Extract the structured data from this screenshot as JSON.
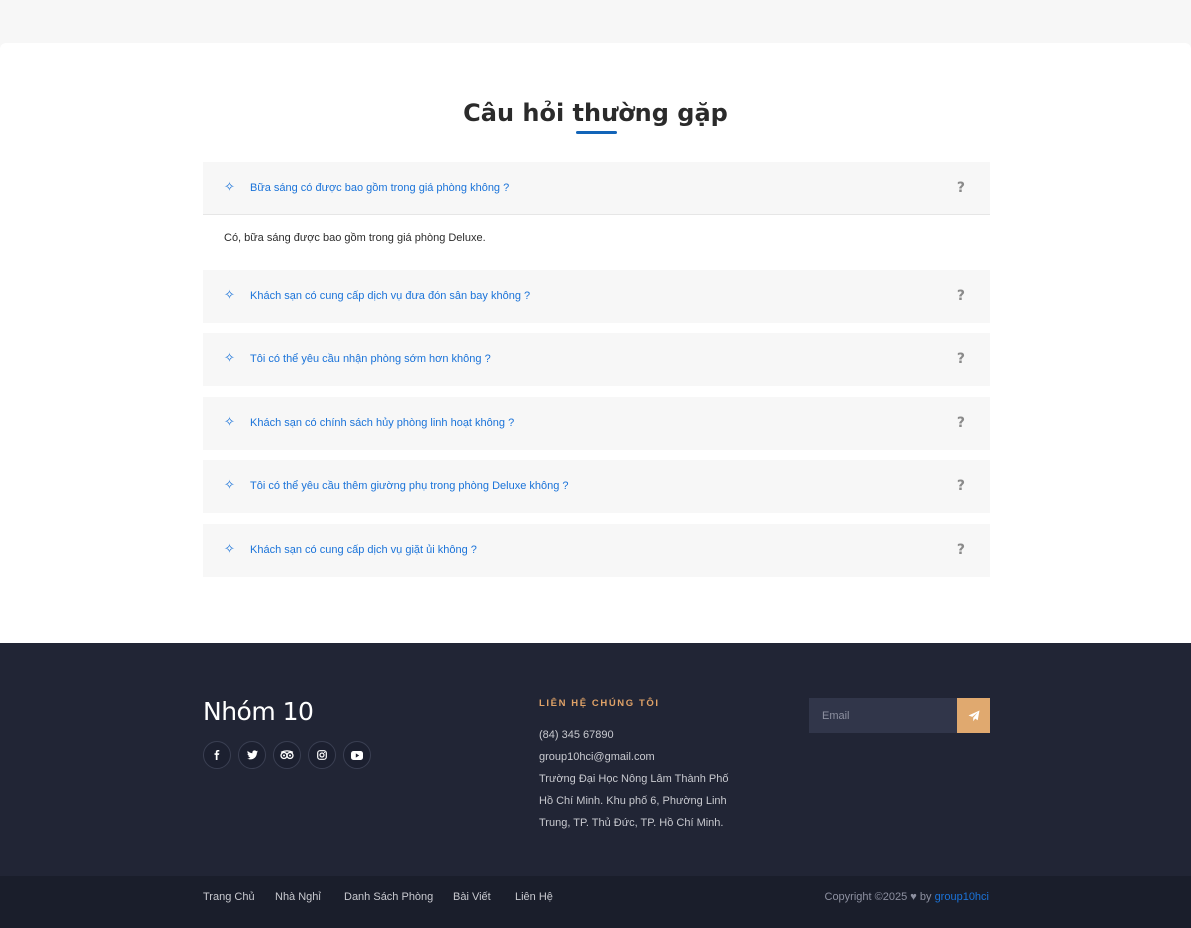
{
  "faq": {
    "title": "Câu hỏi thường gặp",
    "items": [
      {
        "question": "Bữa sáng có được bao gồm trong giá phòng không ?",
        "answer": "Có, bữa sáng được bao gồm trong giá phòng Deluxe."
      },
      {
        "question": "Khách sạn có cung cấp dịch vụ đưa đón sân bay không ?"
      },
      {
        "question": "Tôi có thể yêu cầu nhận phòng sớm hơn không ?"
      },
      {
        "question": "Khách sạn có chính sách hủy phòng linh hoạt không ?"
      },
      {
        "question": "Tôi có thể yêu cầu thêm giường phụ trong phòng Deluxe không ?"
      },
      {
        "question": "Khách sạn có cung cấp dịch vụ giặt ủi không ?"
      }
    ],
    "bullet_icon": "diamond-sparkle-icon",
    "toggle_icon": "question-mark-icon",
    "accent_color": "#1a73d9"
  },
  "footer": {
    "brand": "Nhóm 10",
    "socials": [
      "facebook-icon",
      "twitter-icon",
      "tripadvisor-icon",
      "instagram-icon",
      "youtube-icon"
    ],
    "contact": {
      "heading": "LIÊN HỆ CHÚNG TÔI",
      "phone": "(84) 345 67890",
      "email": "group10hci@gmail.com",
      "address_lines": [
        "Trường Đại Học Nông Lâm Thành Phố",
        "Hồ Chí Minh. Khu phố 6, Phường Linh",
        "Trung, TP. Thủ Đức, TP. Hồ Chí Minh."
      ]
    },
    "newsletter": {
      "placeholder": "Email",
      "send_icon": "paper-plane-icon"
    },
    "nav": [
      "Trang Chủ",
      "Nhà Nghỉ",
      "Danh Sách Phòng",
      "Bài Viết",
      "Liên Hệ"
    ],
    "copyright": {
      "text": "Copyright ©2025",
      "by": "by",
      "author": "group10hci"
    },
    "colors": {
      "background": "#212535",
      "bottom_bar": "#1a1e2b",
      "accent": "#e0a267"
    }
  }
}
